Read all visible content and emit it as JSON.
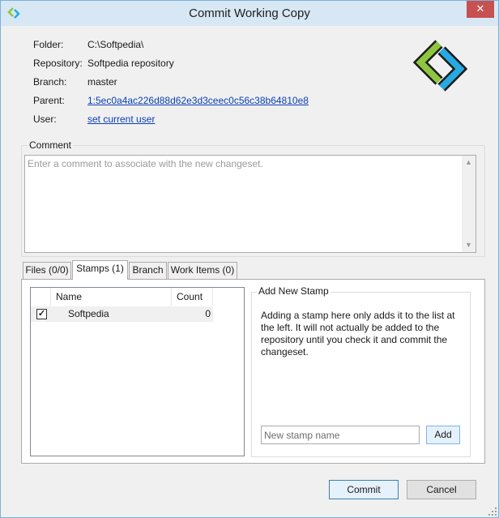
{
  "window": {
    "title": "Commit Working Copy",
    "close_glyph": "✕"
  },
  "info": [
    {
      "label": "Folder:",
      "value": "C:\\Softpedia\\",
      "is_link": false
    },
    {
      "label": "Repository:",
      "value": "Softpedia repository",
      "is_link": false
    },
    {
      "label": "Branch:",
      "value": "master",
      "is_link": false
    },
    {
      "label": "Parent:",
      "value": "1:5ec0a4ac226d88d62e3d3ceec0c56c38b64810e8",
      "is_link": true
    },
    {
      "label": "User:",
      "value": "set current user",
      "is_link": true
    }
  ],
  "comment": {
    "group_label": "Comment",
    "placeholder": "Enter a comment to associate with the new changeset."
  },
  "tabs": [
    {
      "label": "Files (0/0)",
      "active": false
    },
    {
      "label": "Stamps (1)",
      "active": true
    },
    {
      "label": "Branch",
      "active": false
    },
    {
      "label": "Work Items (0)",
      "active": false
    }
  ],
  "stamps": {
    "columns": {
      "name": "Name",
      "count": "Count"
    },
    "rows": [
      {
        "checked": true,
        "name": "Softpedia",
        "count": "0"
      }
    ],
    "add_group_label": "Add New Stamp",
    "help_text": "Adding a stamp here only adds it to the list at the left.  It will not actually be added to the repository until you check it and commit the changeset.",
    "input_placeholder": "New stamp name",
    "add_label": "Add"
  },
  "buttons": {
    "commit": "Commit",
    "cancel": "Cancel"
  },
  "colors": {
    "accent_green": "#8dc63f",
    "accent_blue": "#27a9e1",
    "link": "#0b3fb5"
  },
  "icons": {
    "app": "commit-logo-icon",
    "close": "close-icon",
    "check": "checkmark-icon"
  }
}
